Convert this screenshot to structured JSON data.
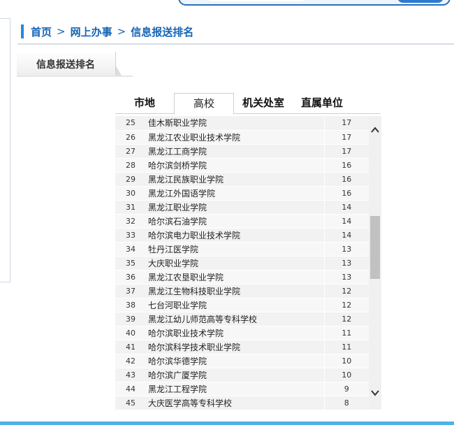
{
  "breadcrumb": {
    "items": [
      "首页",
      "网上办事",
      "信息报送排名"
    ],
    "separator": ">"
  },
  "section_tab": {
    "label": "信息报送排名"
  },
  "category_tabs": [
    {
      "label": "市地",
      "active": false
    },
    {
      "label": "高校",
      "active": true
    },
    {
      "label": "机关处室",
      "active": false
    },
    {
      "label": "直属单位",
      "active": false
    }
  ],
  "ranking_rows": [
    {
      "rank": "25",
      "name": "佳木斯职业学院",
      "count": "17"
    },
    {
      "rank": "26",
      "name": "黑龙江农业职业技术学院",
      "count": "17"
    },
    {
      "rank": "27",
      "name": "黑龙江工商学院",
      "count": "17"
    },
    {
      "rank": "28",
      "name": "哈尔滨剑桥学院",
      "count": "16"
    },
    {
      "rank": "29",
      "name": "黑龙江民族职业学院",
      "count": "16"
    },
    {
      "rank": "30",
      "name": "黑龙江外国语学院",
      "count": "16"
    },
    {
      "rank": "31",
      "name": "黑龙江职业学院",
      "count": "14"
    },
    {
      "rank": "32",
      "name": "哈尔滨石油学院",
      "count": "14"
    },
    {
      "rank": "33",
      "name": "哈尔滨电力职业技术学院",
      "count": "14"
    },
    {
      "rank": "34",
      "name": "牡丹江医学院",
      "count": "13"
    },
    {
      "rank": "35",
      "name": "大庆职业学院",
      "count": "13"
    },
    {
      "rank": "36",
      "name": "黑龙江农垦职业学院",
      "count": "13"
    },
    {
      "rank": "37",
      "name": "黑龙江生物科技职业学院",
      "count": "12"
    },
    {
      "rank": "38",
      "name": "七台河职业学院",
      "count": "12"
    },
    {
      "rank": "39",
      "name": "黑龙江幼儿师范高等专科学校",
      "count": "12"
    },
    {
      "rank": "40",
      "name": "哈尔滨职业技术学院",
      "count": "11"
    },
    {
      "rank": "41",
      "name": "哈尔滨科学技术职业学院",
      "count": "11"
    },
    {
      "rank": "42",
      "name": "哈尔滨华德学院",
      "count": "10"
    },
    {
      "rank": "43",
      "name": "哈尔滨广厦学院",
      "count": "10"
    },
    {
      "rank": "44",
      "name": "黑龙江工程学院",
      "count": "9"
    },
    {
      "rank": "45",
      "name": "大庆医学高等专科学校",
      "count": "8"
    }
  ],
  "colors": {
    "accent": "#2f86d6",
    "link": "#1565b5",
    "footer_bar": "#4db3e6"
  },
  "icons": {
    "scroll_up": "chevron-up-icon",
    "scroll_down": "chevron-down-icon"
  }
}
